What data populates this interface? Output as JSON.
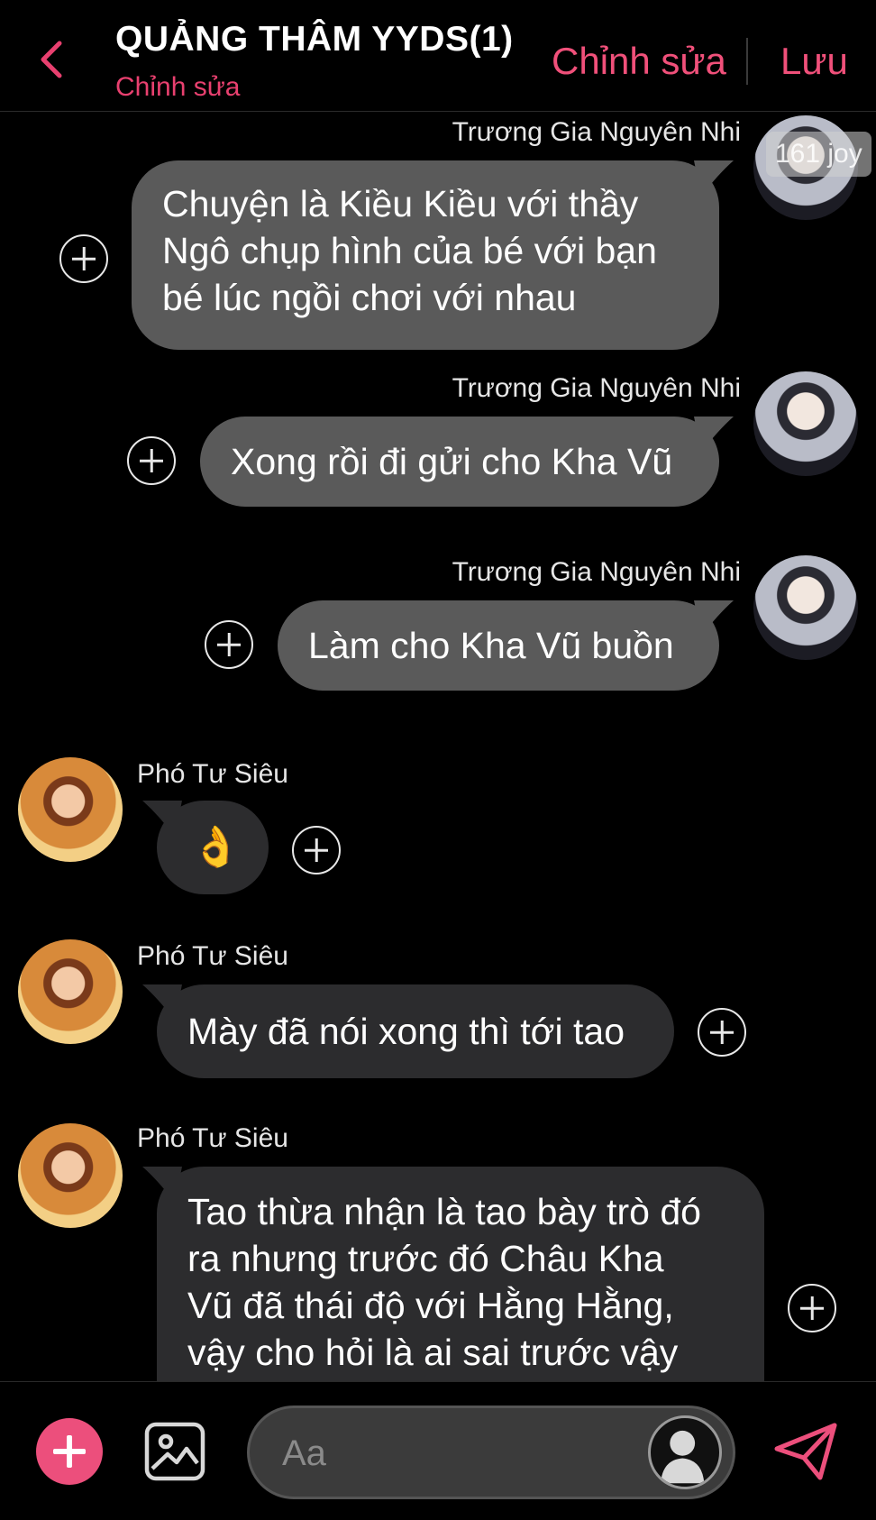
{
  "header": {
    "title": "QUẢNG THÂM YYDS(1)",
    "subtitle": "Chỉnh sửa",
    "edit_label": "Chỉnh sửa",
    "save_label": "Lưu"
  },
  "avatar_badge": "161 joy",
  "messages": [
    {
      "sender": "Trương Gia Nguyên Nhi",
      "lines": [
        "Chuyện là Kiều Kiều với thầy",
        "Ngô chụp hình của bé với bạn",
        "bé lúc ngồi chơi với nhau"
      ]
    },
    {
      "sender": "Trương Gia Nguyên Nhi",
      "lines": [
        "Xong rồi đi gửi cho Kha Vũ"
      ]
    },
    {
      "sender": "Trương Gia Nguyên Nhi",
      "lines": [
        "Làm cho Kha Vũ buồn"
      ]
    },
    {
      "sender": "Phó Tư Siêu",
      "lines": [
        "👌"
      ]
    },
    {
      "sender": "Phó Tư Siêu",
      "lines": [
        "Mày đã nói xong thì tới tao"
      ]
    },
    {
      "sender": "Phó Tư Siêu",
      "lines": [
        "Tao thừa nhận là tao bày trò đó",
        "ra nhưng trước đó Châu Kha",
        "Vũ đã thái độ với Hằng Hằng,",
        "vậy cho hỏi là ai sai trước vậy"
      ]
    }
  ],
  "input": {
    "placeholder": "Aa"
  },
  "colors": {
    "accent": "#ec4f7c",
    "bubble_right": "#5a5a5a",
    "bubble_left": "#2c2c2e"
  }
}
